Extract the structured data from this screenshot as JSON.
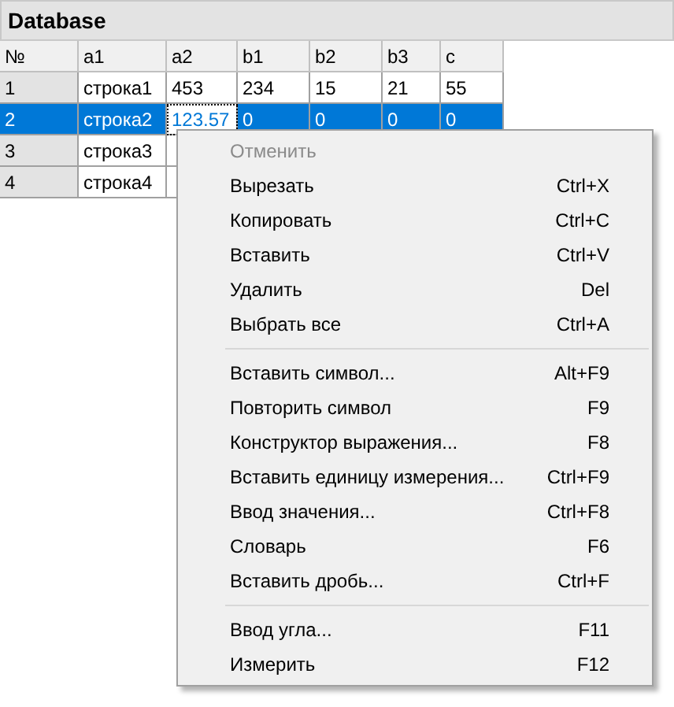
{
  "window": {
    "title": "Database"
  },
  "table": {
    "columns": [
      "№",
      "a1",
      "a2",
      "b1",
      "b2",
      "b3",
      "c"
    ],
    "rows": [
      {
        "selected": false,
        "cells": [
          "1",
          "строка1",
          "453",
          "234",
          "15",
          "21",
          "55"
        ]
      },
      {
        "selected": true,
        "cells": [
          "2",
          "строка2",
          "123.57",
          "0",
          "0",
          "0",
          "0"
        ]
      },
      {
        "selected": false,
        "cells": [
          "3",
          "строка3"
        ]
      },
      {
        "selected": false,
        "cells": [
          "4",
          "строка4"
        ]
      }
    ]
  },
  "context_menu": {
    "items": [
      {
        "kind": "item",
        "label": "Отменить",
        "disabled": true
      },
      {
        "kind": "item",
        "label": "Вырезать",
        "shortcut": "Ctrl+X",
        "disabled": false
      },
      {
        "kind": "item",
        "label": "Копировать",
        "shortcut": "Ctrl+C",
        "disabled": false
      },
      {
        "kind": "item",
        "label": "Вставить",
        "shortcut": "Ctrl+V",
        "disabled": false
      },
      {
        "kind": "item",
        "label": "Удалить",
        "shortcut": "Del",
        "disabled": false
      },
      {
        "kind": "item",
        "label": "Выбрать все",
        "shortcut": "Ctrl+A",
        "disabled": false
      },
      {
        "kind": "separator"
      },
      {
        "kind": "item",
        "label": "Вставить символ...",
        "shortcut": "Alt+F9",
        "disabled": false
      },
      {
        "kind": "item",
        "label": "Повторить символ",
        "shortcut": "F9",
        "disabled": false
      },
      {
        "kind": "item",
        "label": "Конструктор выражения...",
        "shortcut": "F8",
        "disabled": false
      },
      {
        "kind": "item",
        "label": "Вставить единицу измерения...",
        "shortcut": "Ctrl+F9",
        "disabled": false
      },
      {
        "kind": "item",
        "label": "Ввод значения...",
        "shortcut": "Ctrl+F8",
        "disabled": false
      },
      {
        "kind": "item",
        "label": "Словарь",
        "shortcut": "F6",
        "disabled": false
      },
      {
        "kind": "item",
        "label": "Вставить дробь...",
        "shortcut": "Ctrl+F",
        "disabled": false
      },
      {
        "kind": "separator"
      },
      {
        "kind": "item",
        "label": "Ввод угла...",
        "shortcut": "F11",
        "disabled": false
      },
      {
        "kind": "item",
        "label": "Измерить",
        "shortcut": "F12",
        "disabled": false
      }
    ]
  }
}
